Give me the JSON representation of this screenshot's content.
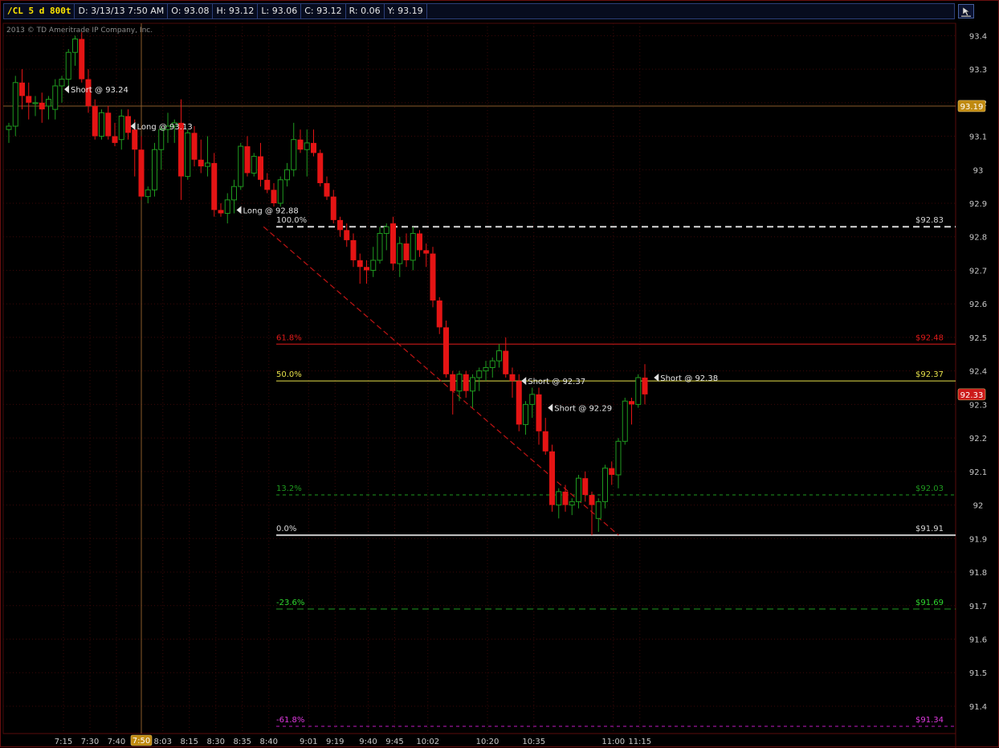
{
  "header": {
    "symbol": "/CL 5 d 800t",
    "date": "D: 3/13/13 7:50 AM",
    "open": "O: 93.08",
    "high": "H: 93.12",
    "low": "L: 93.06",
    "close": "C: 93.12",
    "range": "R: 0.06",
    "y": "Y: 93.19"
  },
  "copyright": "2013 © TD Ameritrade IP Company, Inc.",
  "colors": {
    "up": "#1f9a1f",
    "down": "#e41414",
    "grid": "#3c0808",
    "axis": "#c8c8c8",
    "badge_current": "#cc1a1a",
    "badge_cursor": "#c08a10"
  },
  "chart_data": {
    "type": "candlestick",
    "ylim": [
      91.34,
      93.42
    ],
    "yticks": [
      93.4,
      93.3,
      93.2,
      93.1,
      93,
      92.9,
      92.8,
      92.7,
      92.6,
      92.5,
      92.4,
      92.3,
      92.2,
      92.1,
      92,
      91.9,
      91.8,
      91.7,
      91.6,
      91.5,
      91.4
    ],
    "ytick_labels": [
      "93.4",
      "93.3",
      "93.2",
      "93.1",
      "93",
      "92.9",
      "92.8",
      "92.7",
      "92.6",
      "92.5",
      "92.4",
      "92.3",
      "92.2",
      "92.1",
      "92",
      "91.9",
      "91.8",
      "91.7",
      "91.6",
      "91.5",
      "91.4"
    ],
    "xtick_labels": [
      {
        "i": 4,
        "label": "7:15"
      },
      {
        "i": 8,
        "label": "7:30"
      },
      {
        "i": 12,
        "label": "7:40"
      },
      {
        "i": 19,
        "label": "8:03"
      },
      {
        "i": 23,
        "label": "8:15"
      },
      {
        "i": 27,
        "label": "8:30"
      },
      {
        "i": 31,
        "label": "8:35"
      },
      {
        "i": 35,
        "label": "8:40"
      },
      {
        "i": 41,
        "label": "9:01"
      },
      {
        "i": 45,
        "label": "9:19"
      },
      {
        "i": 50,
        "label": "9:40"
      },
      {
        "i": 54,
        "label": "9:45"
      },
      {
        "i": 59,
        "label": "10:02"
      },
      {
        "i": 68,
        "label": "10:20"
      },
      {
        "i": 75,
        "label": "10:35"
      },
      {
        "i": 87,
        "label": "11:00"
      },
      {
        "i": 91,
        "label": "11:15"
      }
    ],
    "cursor": {
      "i": 16,
      "label": "7:50"
    },
    "current_price": {
      "value": 92.33,
      "label": "92.33"
    },
    "cursor_price": {
      "value": 93.19,
      "label": "93.19"
    },
    "ohlc": [
      [
        93.12,
        93.14,
        93.08,
        93.13
      ],
      [
        93.13,
        93.28,
        93.1,
        93.26
      ],
      [
        93.26,
        93.3,
        93.18,
        93.22
      ],
      [
        93.22,
        93.26,
        93.15,
        93.2
      ],
      [
        93.2,
        93.22,
        93.16,
        93.2
      ],
      [
        93.2,
        93.23,
        93.14,
        93.18
      ],
      [
        93.19,
        93.22,
        93.15,
        93.21
      ],
      [
        93.18,
        93.27,
        93.15,
        93.25
      ],
      [
        93.25,
        93.28,
        93.2,
        93.27
      ],
      [
        93.27,
        93.36,
        93.23,
        93.35
      ],
      [
        93.35,
        93.4,
        93.31,
        93.39
      ],
      [
        93.39,
        93.41,
        93.26,
        93.27
      ],
      [
        93.27,
        93.3,
        93.17,
        93.19
      ],
      [
        93.19,
        93.21,
        93.09,
        93.1
      ],
      [
        93.1,
        93.18,
        93.09,
        93.17
      ],
      [
        93.17,
        93.19,
        93.09,
        93.1
      ],
      [
        93.1,
        93.14,
        93.07,
        93.08
      ],
      [
        93.09,
        93.18,
        93.06,
        93.16
      ],
      [
        93.16,
        93.18,
        93.09,
        93.11
      ],
      [
        93.12,
        93.15,
        92.98,
        93.06
      ],
      [
        93.06,
        93.1,
        92.91,
        92.92
      ],
      [
        92.92,
        92.95,
        92.9,
        92.94
      ],
      [
        92.94,
        93.08,
        92.92,
        93.06
      ],
      [
        93.06,
        93.13,
        93.0,
        93.12
      ],
      [
        93.12,
        93.17,
        93.08,
        93.13
      ],
      [
        93.13,
        93.15,
        93.08,
        93.14
      ],
      [
        93.14,
        93.21,
        92.91,
        92.98
      ],
      [
        92.98,
        93.12,
        92.97,
        93.11
      ],
      [
        93.11,
        93.13,
        93.01,
        93.03
      ],
      [
        93.03,
        93.09,
        92.99,
        93.01
      ],
      [
        93.01,
        93.1,
        92.98,
        93.02
      ],
      [
        93.02,
        93.05,
        92.86,
        92.88
      ],
      [
        92.88,
        92.9,
        92.86,
        92.87
      ],
      [
        92.87,
        92.93,
        92.84,
        92.91
      ],
      [
        92.91,
        92.97,
        92.87,
        92.95
      ],
      [
        92.95,
        93.08,
        92.94,
        93.07
      ],
      [
        93.07,
        93.1,
        92.98,
        92.99
      ],
      [
        92.99,
        93.05,
        92.98,
        93.04
      ],
      [
        93.04,
        93.08,
        92.95,
        92.97
      ],
      [
        92.97,
        92.99,
        92.93,
        92.94
      ],
      [
        92.94,
        92.96,
        92.89,
        92.9
      ],
      [
        92.9,
        92.98,
        92.89,
        92.97
      ],
      [
        92.97,
        93.02,
        92.95,
        93.0
      ],
      [
        93.0,
        93.14,
        92.98,
        93.09
      ],
      [
        93.09,
        93.12,
        93.05,
        93.06
      ],
      [
        93.06,
        93.12,
        92.98,
        93.08
      ],
      [
        93.08,
        93.12,
        93.04,
        93.05
      ],
      [
        93.05,
        93.06,
        92.95,
        92.96
      ],
      [
        92.96,
        92.98,
        92.91,
        92.92
      ],
      [
        92.92,
        92.94,
        92.84,
        92.85
      ],
      [
        92.85,
        92.86,
        92.8,
        92.82
      ],
      [
        92.82,
        92.84,
        92.77,
        92.79
      ],
      [
        92.79,
        92.81,
        92.71,
        92.73
      ],
      [
        92.73,
        92.75,
        92.66,
        92.71
      ],
      [
        92.71,
        92.73,
        92.66,
        92.7
      ],
      [
        92.7,
        92.77,
        92.68,
        92.73
      ],
      [
        92.73,
        92.83,
        92.72,
        92.81
      ],
      [
        92.81,
        92.84,
        92.76,
        92.83
      ],
      [
        92.84,
        92.86,
        92.7,
        92.72
      ],
      [
        92.72,
        92.8,
        92.68,
        92.78
      ],
      [
        92.78,
        92.81,
        92.71,
        92.73
      ],
      [
        92.73,
        92.83,
        92.7,
        92.81
      ],
      [
        92.81,
        92.82,
        92.74,
        92.76
      ],
      [
        92.76,
        92.78,
        92.71,
        92.75
      ],
      [
        92.75,
        92.77,
        92.59,
        92.61
      ],
      [
        92.61,
        92.62,
        92.51,
        92.53
      ],
      [
        92.53,
        92.55,
        92.38,
        92.39
      ],
      [
        92.39,
        92.4,
        92.27,
        92.34
      ],
      [
        92.34,
        92.4,
        92.31,
        92.39
      ],
      [
        92.39,
        92.4,
        92.32,
        92.34
      ],
      [
        92.34,
        92.39,
        92.29,
        92.38
      ],
      [
        92.38,
        92.41,
        92.34,
        92.4
      ],
      [
        92.4,
        92.43,
        92.37,
        92.41
      ],
      [
        92.41,
        92.44,
        92.38,
        92.43
      ],
      [
        92.43,
        92.48,
        92.41,
        92.46
      ],
      [
        92.46,
        92.5,
        92.38,
        92.39
      ],
      [
        92.39,
        92.41,
        92.32,
        92.37
      ],
      [
        92.37,
        92.39,
        92.22,
        92.24
      ],
      [
        92.24,
        92.31,
        92.21,
        92.3
      ],
      [
        92.3,
        92.35,
        92.26,
        92.33
      ],
      [
        92.33,
        92.35,
        92.18,
        92.22
      ],
      [
        92.22,
        92.26,
        92.15,
        92.16
      ],
      [
        92.16,
        92.18,
        91.98,
        92.0
      ],
      [
        92.0,
        92.05,
        91.96,
        92.04
      ],
      [
        92.04,
        92.06,
        91.98,
        92.0
      ],
      [
        92.0,
        92.02,
        91.97,
        92.01
      ],
      [
        92.01,
        92.09,
        91.99,
        92.08
      ],
      [
        92.08,
        92.1,
        92.01,
        92.03
      ],
      [
        92.03,
        92.04,
        91.91,
        92.0
      ],
      [
        91.96,
        92.02,
        91.92,
        92.01
      ],
      [
        92.01,
        92.12,
        91.99,
        92.11
      ],
      [
        92.11,
        92.13,
        92.06,
        92.09
      ],
      [
        92.09,
        92.2,
        92.05,
        92.19
      ],
      [
        92.19,
        92.32,
        92.18,
        92.31
      ],
      [
        92.31,
        92.32,
        92.24,
        92.3
      ],
      [
        92.3,
        92.39,
        92.29,
        92.38
      ],
      [
        92.38,
        92.42,
        92.3,
        92.33
      ]
    ],
    "fib_levels": [
      {
        "pct": "100.0%",
        "value": 92.83,
        "price_label": "$92.83",
        "color": "#d8d8d8",
        "style": "long-dash",
        "pct_color": "#d8d8d8"
      },
      {
        "pct": "61.8%",
        "value": 92.48,
        "price_label": "$92.48",
        "color": "#e01a1a",
        "style": "solid",
        "pct_color": "#e01a1a"
      },
      {
        "pct": "50.0%",
        "value": 92.37,
        "price_label": "$92.37",
        "color": "#e6e04a",
        "style": "solid",
        "pct_color": "#e6e04a"
      },
      {
        "pct": "13.2%",
        "value": 92.03,
        "price_label": "$92.03",
        "color": "#1f9a1f",
        "style": "dash",
        "pct_color": "#1f9a1f"
      },
      {
        "pct": "0.0%",
        "value": 91.91,
        "price_label": "$91.91",
        "color": "#c8c8c8",
        "style": "solid-thick",
        "pct_color": "#d8d8d8"
      },
      {
        "pct": "-23.6%",
        "value": 91.69,
        "price_label": "$91.69",
        "color": "#1f9a1f",
        "style": "long-dash",
        "pct_color": "#2fd82f"
      },
      {
        "pct": "-61.8%",
        "value": 91.34,
        "price_label": "$91.34",
        "color": "#c01ac0",
        "style": "dash",
        "pct_color": "#e03ae0"
      }
    ],
    "trendline": {
      "from_i": 34.2,
      "from_value": 92.83,
      "to_i": 87.8,
      "to_value": 91.91,
      "color": "#c01414"
    },
    "orders": [
      {
        "i": 8,
        "value": 93.24,
        "label": "Short @ 93.24"
      },
      {
        "i": 18,
        "value": 93.13,
        "label": "Long @ 93.13"
      },
      {
        "i": 34,
        "value": 92.88,
        "label": "Long @ 92.88"
      },
      {
        "i": 77,
        "value": 92.37,
        "label": "Short @ 92.37"
      },
      {
        "i": 81,
        "value": 92.29,
        "label": "Short @ 92.29"
      },
      {
        "i": 97,
        "value": 92.38,
        "label": "Short @ 92.38"
      }
    ]
  }
}
